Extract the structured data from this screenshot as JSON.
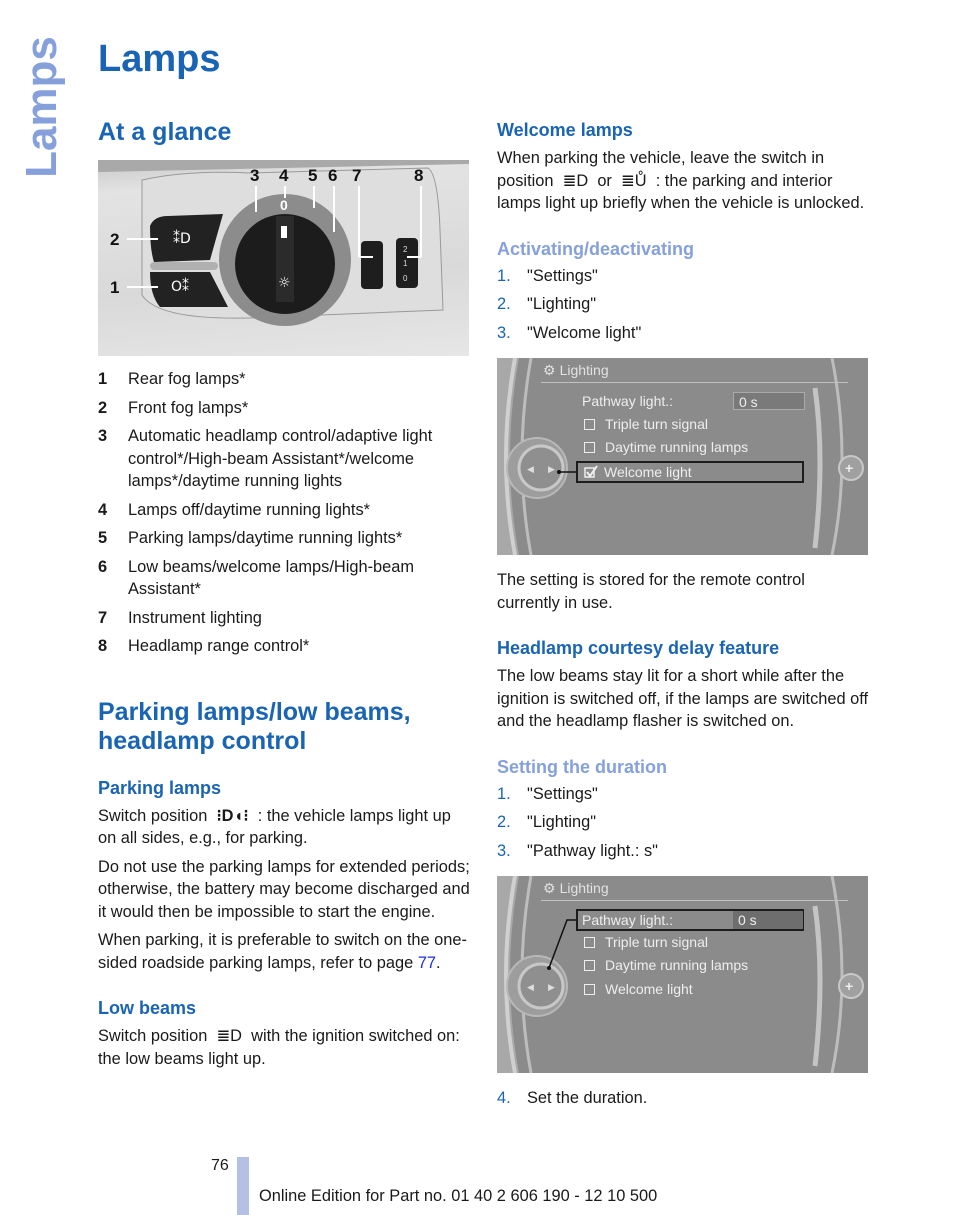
{
  "side_tab": "Lamps",
  "page_title": "Lamps",
  "left": {
    "at_a_glance": {
      "heading": "At a glance",
      "callouts": [
        "1",
        "2",
        "3",
        "4",
        "5",
        "6",
        "7",
        "8"
      ],
      "dial_label": "0",
      "range_labels": [
        "2",
        "1",
        "0"
      ],
      "legend": [
        {
          "num": "1",
          "text": "Rear fog lamps*"
        },
        {
          "num": "2",
          "text": "Front fog lamps*"
        },
        {
          "num": "3",
          "text": "Automatic headlamp control/adaptive light control*/High-beam Assistant*/welcome lamps*/daytime running lights"
        },
        {
          "num": "4",
          "text": "Lamps off/daytime running lights*"
        },
        {
          "num": "5",
          "text": "Parking lamps/daytime running lights*"
        },
        {
          "num": "6",
          "text": "Low beams/welcome lamps/High-beam Assistant*"
        },
        {
          "num": "7",
          "text": "Instrument lighting"
        },
        {
          "num": "8",
          "text": "Headlamp range control*"
        }
      ]
    },
    "parking_section": {
      "heading": "Parking lamps/low beams, headlamp control",
      "parking_lamps": {
        "heading": "Parking lamps",
        "p1_before": "Switch position",
        "p1_after": ": the vehicle lamps light up on all sides, e.g., for parking.",
        "p2": "Do not use the parking lamps for extended periods; otherwise, the battery may become discharged and it would then be impossible to start the engine.",
        "p3_before": "When parking, it is preferable to switch on the one-sided roadside parking lamps, refer to page",
        "p3_link": "77",
        "p3_after": "."
      },
      "low_beams": {
        "heading": "Low beams",
        "p_before": "Switch position",
        "p_after": "with the ignition switched on: the low beams light up."
      }
    }
  },
  "right": {
    "welcome_lamps": {
      "heading": "Welcome lamps",
      "p_before": "When parking the vehicle, leave the switch in position",
      "p_or": "or",
      "p_after": ": the parking and interior lamps light up briefly when the vehicle is unlocked."
    },
    "activating": {
      "heading": "Activating/deactivating",
      "steps": [
        {
          "n": "1.",
          "text": "\"Settings\""
        },
        {
          "n": "2.",
          "text": "\"Lighting\""
        },
        {
          "n": "3.",
          "text": "\"Welcome light\""
        }
      ]
    },
    "screen1": {
      "title": "Lighting",
      "pathway_label": "Pathway light.:",
      "pathway_value": "0 s",
      "options": [
        {
          "label": "Triple turn signal",
          "checked": false
        },
        {
          "label": "Daytime running lamps",
          "checked": false
        },
        {
          "label": "Welcome light",
          "checked": true
        }
      ],
      "selected": "Welcome light"
    },
    "stored_note": "The setting is stored for the remote control currently in use.",
    "courtesy": {
      "heading": "Headlamp courtesy delay feature",
      "p": "The low beams stay lit for a short while after the ignition is switched off, if the lamps are switched off and the headlamp flasher is switched on."
    },
    "duration": {
      "heading": "Setting the duration",
      "steps": [
        {
          "n": "1.",
          "text": "\"Settings\""
        },
        {
          "n": "2.",
          "text": "\"Lighting\""
        },
        {
          "n": "3.",
          "text": "\"Pathway light.: s\""
        }
      ],
      "step4": {
        "n": "4.",
        "text": "Set the duration."
      }
    },
    "screen2": {
      "title": "Lighting",
      "pathway_label": "Pathway light.:",
      "pathway_value": "0 s",
      "options": [
        {
          "label": "Triple turn signal",
          "checked": false
        },
        {
          "label": "Daytime running lamps",
          "checked": false
        },
        {
          "label": "Welcome light",
          "checked": false
        }
      ],
      "selected": "Pathway light.:"
    }
  },
  "footer": {
    "page_number": "76",
    "edition": "Online Edition for Part no. 01 40 2 606 190 - 12 10 500"
  },
  "colors": {
    "heading_blue": "#1a64b4",
    "subheading_light_blue": "#86a0dc",
    "link_blue": "#1f2fdb",
    "footer_bar": "#b4c0e4"
  }
}
